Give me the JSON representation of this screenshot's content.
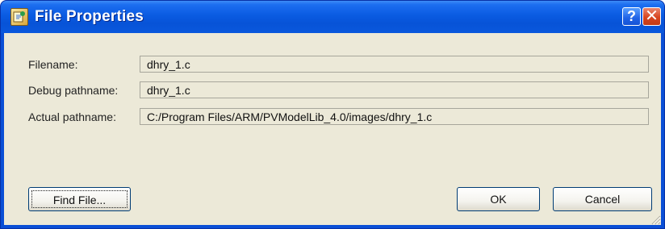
{
  "window": {
    "title": "File Properties",
    "help_label": "?",
    "close_label": "✕"
  },
  "fields": [
    {
      "label": "Filename:",
      "value": "dhry_1.c"
    },
    {
      "label": "Debug pathname:",
      "value": "dhry_1.c"
    },
    {
      "label": "Actual pathname:",
      "value": "C:/Program Files/ARM/PVModelLib_4.0/images/dhry_1.c"
    }
  ],
  "buttons": {
    "find_file": "Find File...",
    "ok": "OK",
    "cancel": "Cancel"
  },
  "colors": {
    "titlebar": "#0a5be2",
    "client": "#ece9d8",
    "close": "#d8451f"
  },
  "icons": [
    "app-icon",
    "help-icon",
    "close-icon",
    "resize-grip-icon"
  ]
}
